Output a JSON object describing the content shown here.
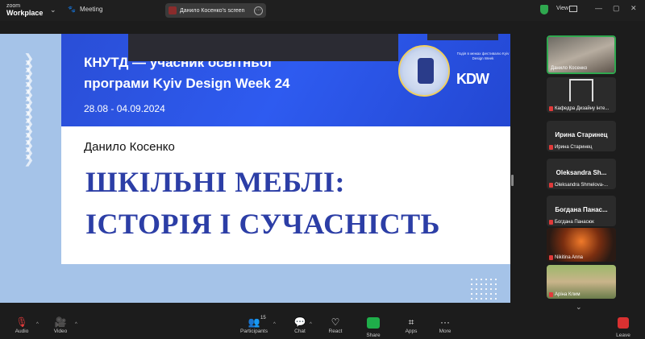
{
  "titlebar": {
    "logo_line1": "zoom",
    "logo_line2": "Workplace",
    "meeting_label": "Meeting",
    "screen_share_label": "Данило Косенко's screen",
    "view_label": "View"
  },
  "slide": {
    "banner_line1": "КНУТД — учасник освітньої",
    "banner_line2": "програми Kyiv Design Week 24",
    "dates": "28.08 - 04.09.2024",
    "partner_small": "Подія в межах фестивалю Kyiv Design Week",
    "partner_logo": "KDW",
    "author": "Данило Косенко",
    "title_line1": "ШКІЛЬНІ МЕБЛІ:",
    "title_line2": "ІСТОРІЯ І СУЧАСНІСТЬ"
  },
  "participants": [
    {
      "name": "Данило Косенко",
      "type": "video",
      "active": true
    },
    {
      "name": "Кафедра Дизайну інте...",
      "type": "video",
      "muted": true
    },
    {
      "big": "Ирина Старинец",
      "name": "Ирина Старинец",
      "type": "name",
      "muted": true
    },
    {
      "big": "Oleksandra  Sh...",
      "name": "Oleksandra Shmelova-...",
      "type": "name",
      "muted": true
    },
    {
      "big": "Богдана  Панас...",
      "name": "Богдана Панасюк",
      "type": "name",
      "muted": true
    },
    {
      "name": "Nikitina Anna",
      "type": "video",
      "muted": true
    },
    {
      "name": "Аріна Клим",
      "type": "video",
      "muted": true
    }
  ],
  "toolbar": {
    "audio": "Audio",
    "video": "Video",
    "participants": "Participants",
    "participants_count": "15",
    "chat": "Chat",
    "react": "React",
    "share": "Share",
    "apps": "Apps",
    "more": "More",
    "leave": "Leave"
  }
}
